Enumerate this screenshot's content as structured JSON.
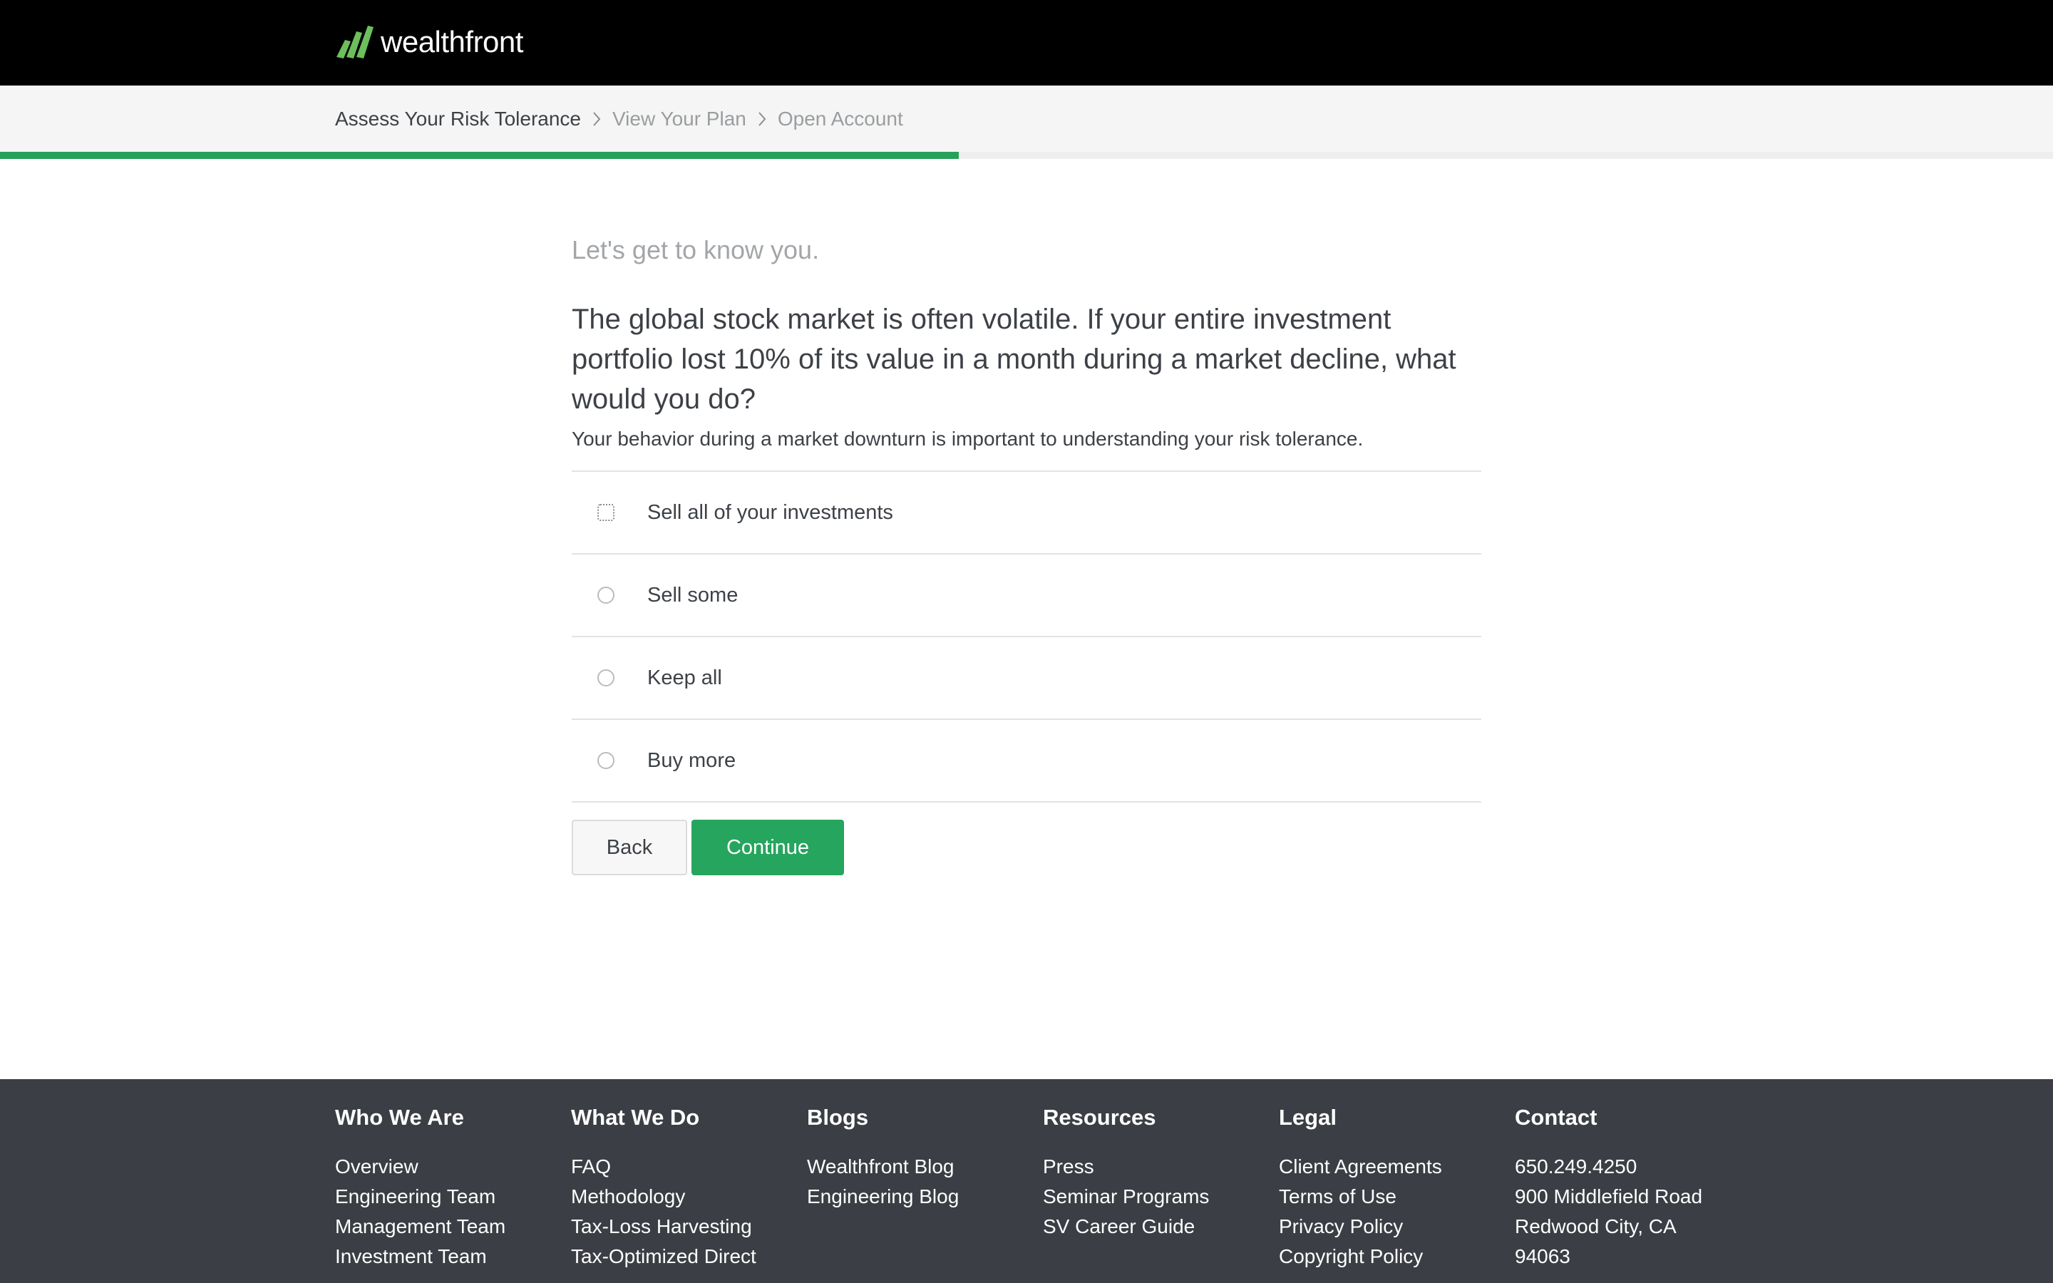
{
  "header": {
    "brand": "wealthfront",
    "logo_icon": "wealthfront-logo-icon",
    "brand_color": "#6cbf5b"
  },
  "breadcrumb": {
    "steps": [
      {
        "label": "Assess Your Risk Tolerance",
        "active": true
      },
      {
        "label": "View Your Plan",
        "active": false
      },
      {
        "label": "Open Account",
        "active": false
      }
    ],
    "separator_icon": "chevron-right-icon"
  },
  "progress": {
    "fraction": 0.467,
    "color": "#27a05a"
  },
  "question": {
    "eyebrow": "Let's get to know you.",
    "text": "The global stock market is often volatile. If your entire investment portfolio lost 10% of its value in a month during a market decline, what would you do?",
    "subtext": "Your behavior during a market downturn is important to understanding your risk tolerance.",
    "options": [
      {
        "label": "Sell all of your investments",
        "focused": true
      },
      {
        "label": "Sell some",
        "focused": false
      },
      {
        "label": "Keep all",
        "focused": false
      },
      {
        "label": "Buy more",
        "focused": false
      }
    ]
  },
  "actions": {
    "back_label": "Back",
    "continue_label": "Continue",
    "continue_color": "#26a55e"
  },
  "footer": {
    "columns": [
      {
        "title": "Who We Are",
        "items": [
          "Overview",
          "Engineering Team",
          "Management Team",
          "Investment Team"
        ]
      },
      {
        "title": "What We Do",
        "items": [
          "FAQ",
          "Methodology",
          "Tax-Loss Harvesting",
          "Tax-Optimized Direct"
        ]
      },
      {
        "title": "Blogs",
        "items": [
          "Wealthfront Blog",
          "Engineering Blog"
        ]
      },
      {
        "title": "Resources",
        "items": [
          "Press",
          "Seminar Programs",
          "SV Career Guide"
        ]
      },
      {
        "title": "Legal",
        "items": [
          "Client Agreements",
          "Terms of Use",
          "Privacy Policy",
          "Copyright Policy"
        ]
      },
      {
        "title": "Contact",
        "items": [
          "650.249.4250",
          "900 Middlefield Road",
          "Redwood City, CA",
          "94063"
        ]
      }
    ]
  }
}
